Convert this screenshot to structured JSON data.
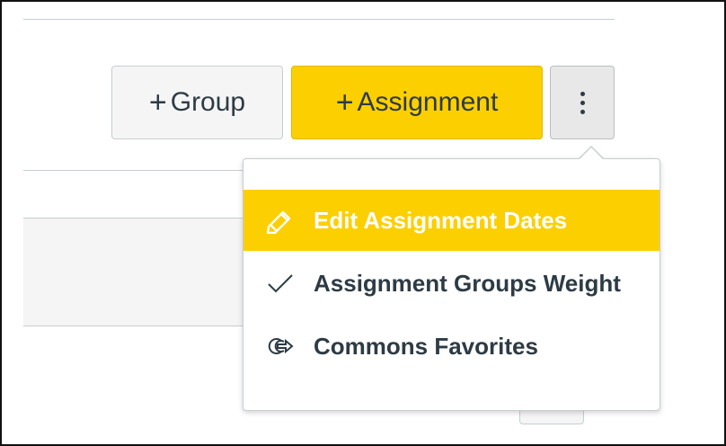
{
  "toolbar": {
    "group_button": {
      "plus": "+",
      "label": "Group"
    },
    "assignment_button": {
      "plus": "+",
      "label": "Assignment"
    },
    "more_button": {
      "icon": "kebab-vertical-icon"
    }
  },
  "menu": {
    "items": [
      {
        "label": "Edit Assignment Dates",
        "icon": "pencil-icon",
        "active": true
      },
      {
        "label": "Assignment Groups Weight",
        "icon": "checkmark-icon",
        "active": false
      },
      {
        "label": "Commons Favorites",
        "icon": "commons-share-icon",
        "active": false
      }
    ]
  },
  "colors": {
    "accent": "#fccf00",
    "text": "#2d3b45",
    "border": "#c7cdd1",
    "muted_bg": "#f5f5f5"
  }
}
